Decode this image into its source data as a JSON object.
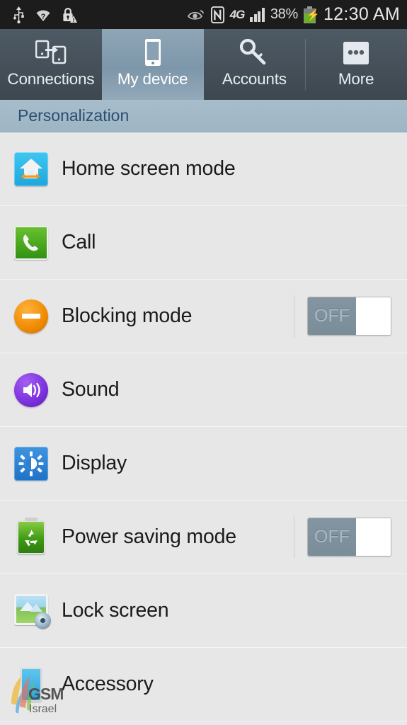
{
  "status_bar": {
    "left_icons": [
      "usb-icon",
      "wifi-question-icon",
      "lock-warning-icon"
    ],
    "right_icons": [
      "smart-stay-eye-icon",
      "nfc-icon",
      "network-4g-icon",
      "signal-bars-icon",
      "battery-charging-icon"
    ],
    "network_type": "4G",
    "battery_percent": "38%",
    "time": "12:30 AM"
  },
  "tabs": [
    {
      "label": "Connections",
      "icon": "connections-icon",
      "active": false
    },
    {
      "label": "My device",
      "icon": "device-phone-icon",
      "active": true
    },
    {
      "label": "Accounts",
      "icon": "key-icon",
      "active": false
    },
    {
      "label": "More",
      "icon": "more-dots-icon",
      "active": false
    }
  ],
  "section": {
    "title": "Personalization"
  },
  "rows": [
    {
      "label": "Home screen mode",
      "icon": "home-screen-mode-icon",
      "toggle": null
    },
    {
      "label": "Call",
      "icon": "call-phone-icon",
      "toggle": null
    },
    {
      "label": "Blocking mode",
      "icon": "blocking-mode-icon",
      "toggle": "OFF"
    },
    {
      "label": "Sound",
      "icon": "sound-speaker-icon",
      "toggle": null
    },
    {
      "label": "Display",
      "icon": "display-brightness-icon",
      "toggle": null
    },
    {
      "label": "Power saving mode",
      "icon": "power-saving-icon",
      "toggle": "OFF"
    },
    {
      "label": "Lock screen",
      "icon": "lock-screen-icon",
      "toggle": null
    },
    {
      "label": "Accessory",
      "icon": "accessory-icon",
      "toggle": null
    }
  ],
  "watermark": {
    "line1": "GSM",
    "line2": "Israel"
  },
  "colors": {
    "status_bar_bg": "#1c1c1c",
    "tab_bar_bg": "#454f59",
    "tab_active_bg": "#8aa1b3",
    "section_bg": "#a2b8c7",
    "section_text": "#294f70",
    "list_bg": "#e7e7e7",
    "divider": "#cfcfcf",
    "toggle_off": "#7e919d",
    "battery_green": "#6ab023"
  }
}
